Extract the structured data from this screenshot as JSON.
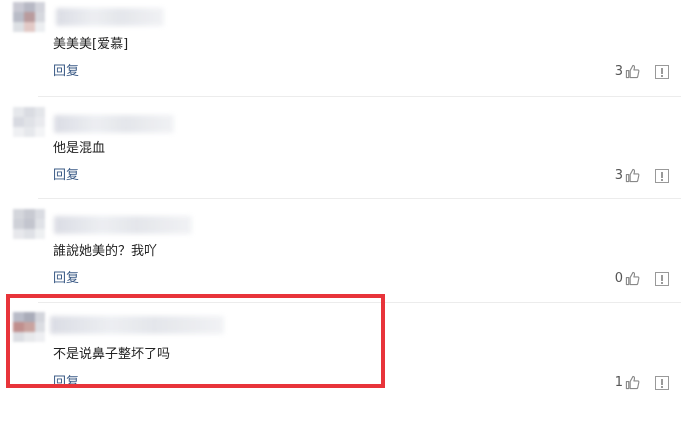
{
  "comments": [
    {
      "content": "美美美[爱慕]",
      "reply_label": "回复",
      "likes": "3"
    },
    {
      "content": "他是混血",
      "reply_label": "回复",
      "likes": "3"
    },
    {
      "content": "誰說她美的？我吖",
      "reply_label": "回复",
      "likes": "0"
    },
    {
      "content": "不是说鼻子整坏了吗",
      "reply_label": "回复",
      "likes": "1"
    }
  ],
  "icons": {
    "like": "thumbs-up-icon",
    "report": "report-icon"
  },
  "colors": {
    "highlight": "#e8343a",
    "reply_link": "#3b5b86"
  }
}
